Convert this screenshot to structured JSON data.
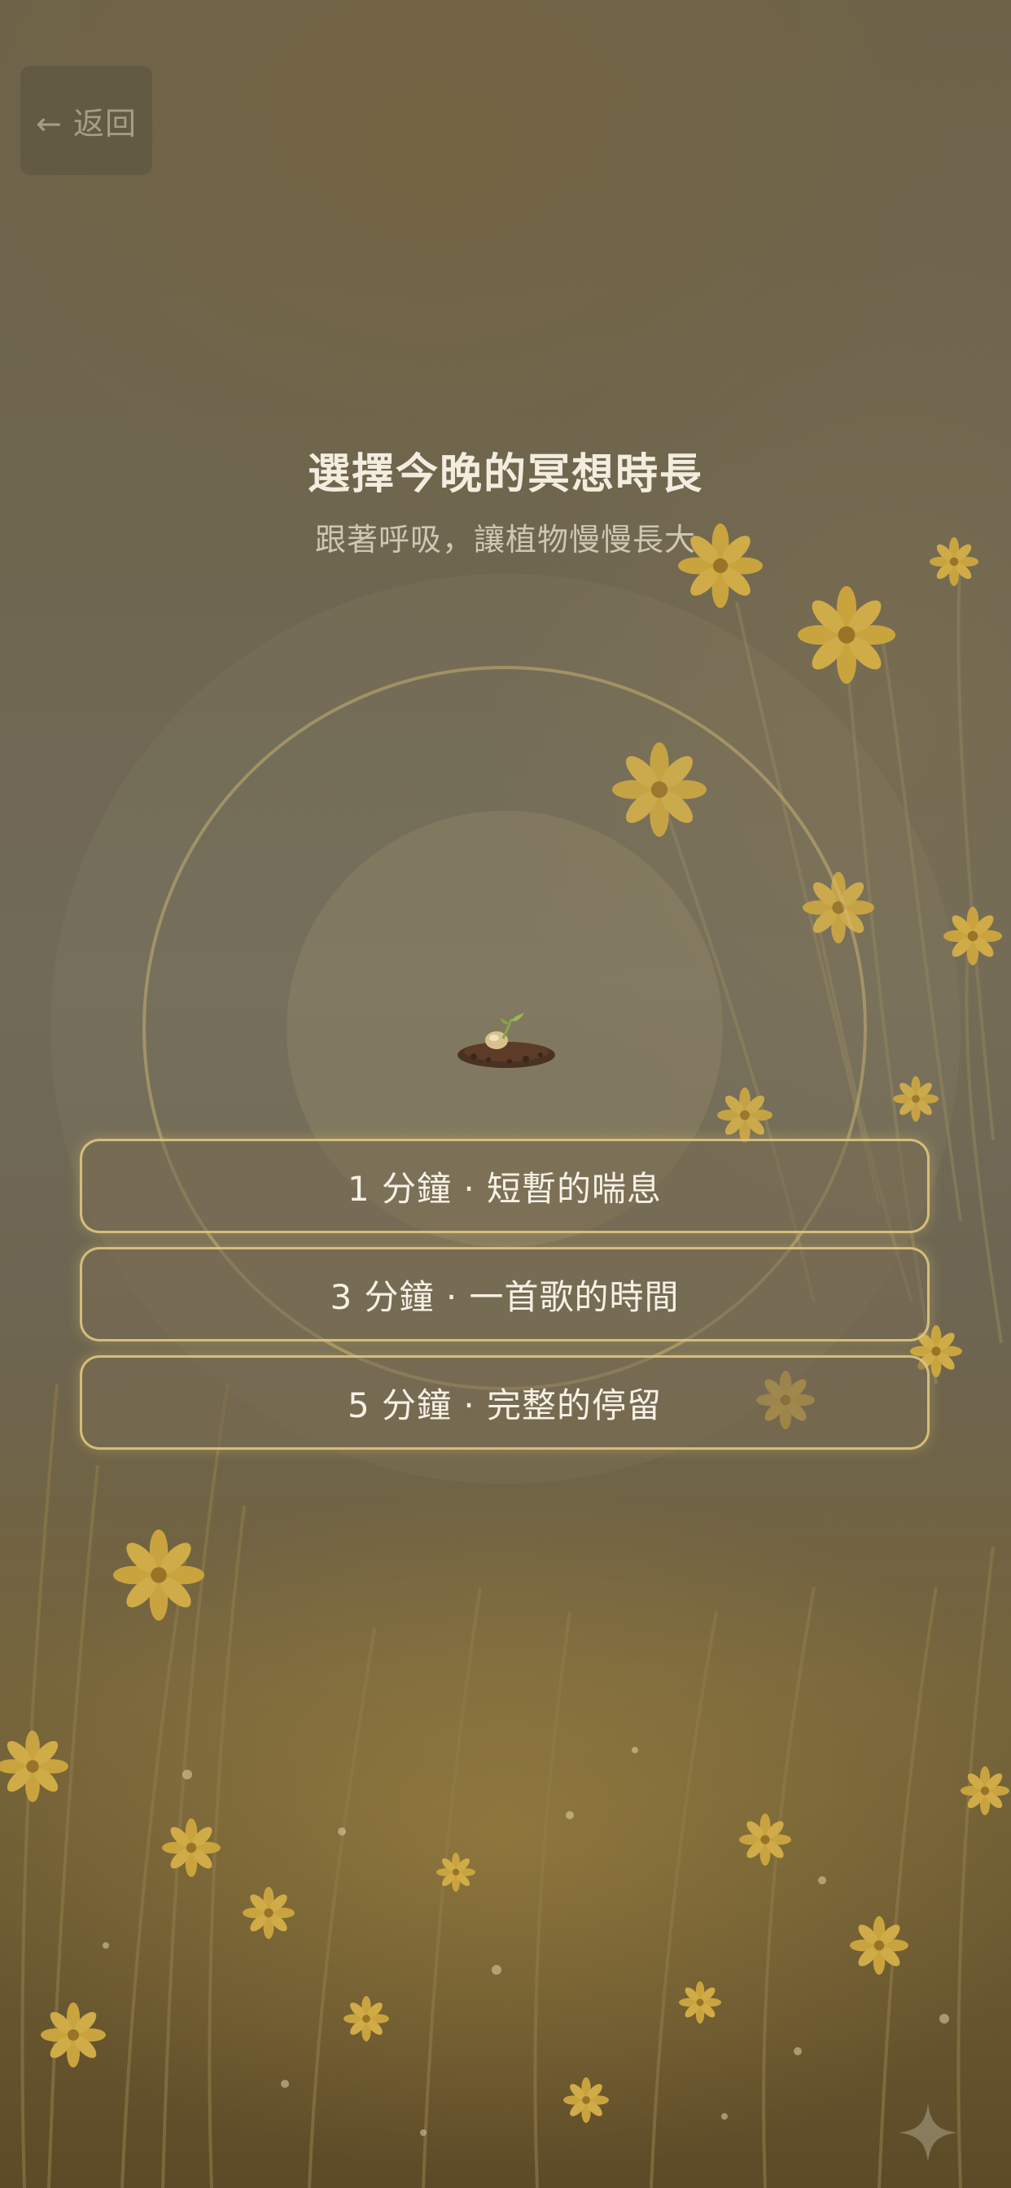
{
  "header": {
    "back_label": "← 返回"
  },
  "main": {
    "title": "選擇今晚的冥想時長",
    "subtitle": "跟著呼吸，讓植物慢慢長大"
  },
  "options": [
    {
      "label": "1 分鐘 · 短暫的喘息"
    },
    {
      "label": "3 分鐘 · 一首歌的時間"
    },
    {
      "label": "5 分鐘 · 完整的停留"
    }
  ],
  "icons": {
    "back": "back-arrow-icon",
    "seed": "seed-sprout-icon",
    "sparkle": "sparkle-icon"
  },
  "colors": {
    "accent_border": "#e6cd82",
    "title_text": "#f3ede0",
    "subtitle_text": "#cfc6b3",
    "background": "#6e6550"
  }
}
